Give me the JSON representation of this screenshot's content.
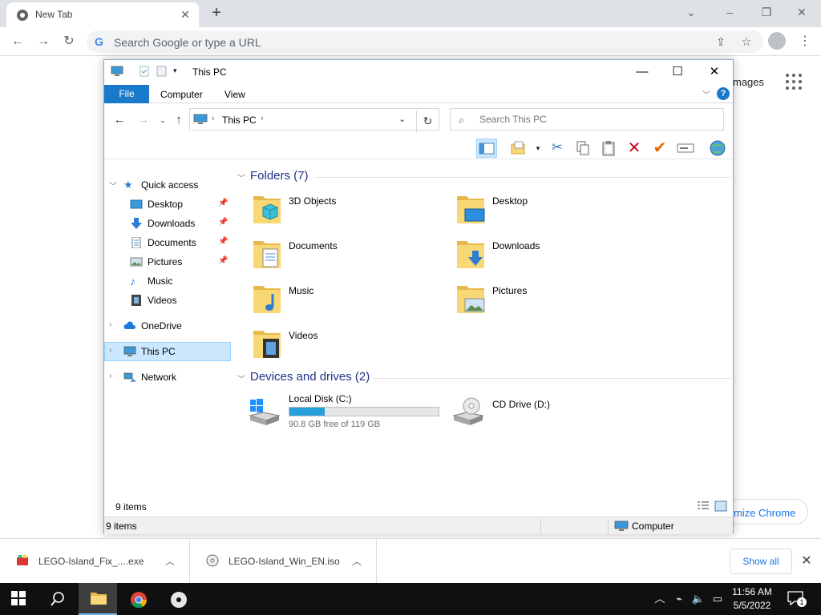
{
  "chrome": {
    "tab_title": "New Tab",
    "omnibox_placeholder": "Search Google or type a URL",
    "ntp_images_link": "mages",
    "customize_label": "mize Chrome"
  },
  "explorer": {
    "title": "This PC",
    "ribbon_tabs": {
      "file": "File",
      "computer": "Computer",
      "view": "View"
    },
    "help": "?",
    "breadcrumb": "This PC",
    "search_placeholder": "Search This PC",
    "nav": {
      "quick_access": "Quick access",
      "desktop": "Desktop",
      "downloads": "Downloads",
      "documents": "Documents",
      "pictures": "Pictures",
      "music": "Music",
      "videos": "Videos",
      "onedrive": "OneDrive",
      "this_pc": "This PC",
      "network": "Network"
    },
    "folders_header": "Folders (7)",
    "folders": [
      "3D Objects",
      "Desktop",
      "Documents",
      "Downloads",
      "Music",
      "Pictures",
      "Videos"
    ],
    "drives_header": "Devices and drives (2)",
    "drives": [
      {
        "label": "Local Disk (C:)",
        "free": "90.8 GB free of 119 GB",
        "used_fraction": 0.237
      },
      {
        "label": "CD Drive (D:)"
      }
    ],
    "item_count": "9 items",
    "status_count": "9 items",
    "status_location": "Computer"
  },
  "downloads": [
    {
      "name": "LEGO-Island_Fix_....exe"
    },
    {
      "name": "LEGO-Island_Win_EN.iso"
    }
  ],
  "show_all": "Show all",
  "taskbar": {
    "time": "11:56 AM",
    "date": "5/5/2022",
    "notification_count": "1"
  },
  "colors": {
    "accent": "#1979ca",
    "folder_yellow": "#f8d775",
    "selection": "#cce8ff",
    "drive_bar": "#26a0da",
    "chrome_link": "#1a73e8"
  }
}
